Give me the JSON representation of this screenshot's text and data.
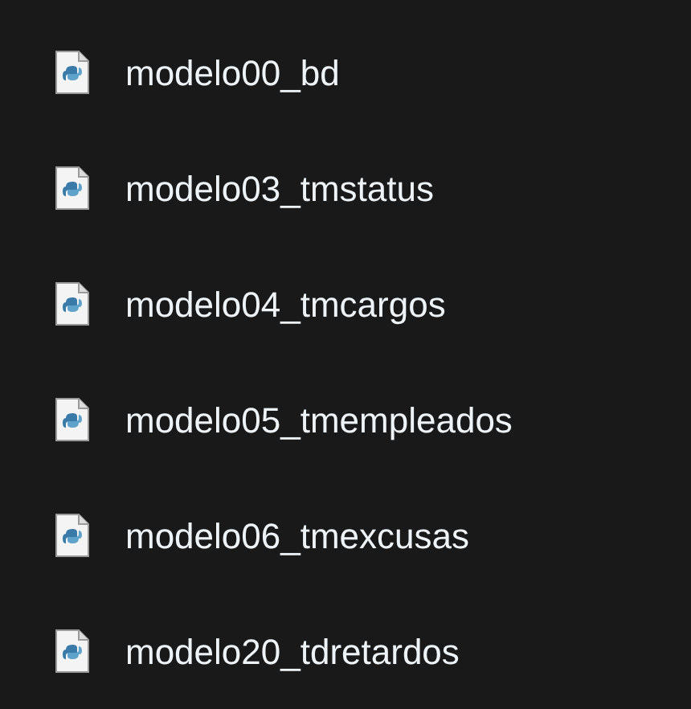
{
  "files": [
    {
      "name": "modelo00_bd"
    },
    {
      "name": "modelo03_tmstatus"
    },
    {
      "name": "modelo04_tmcargos"
    },
    {
      "name": "modelo05_tmempleados"
    },
    {
      "name": "modelo06_tmexcusas"
    },
    {
      "name": "modelo20_tdretardos"
    }
  ]
}
